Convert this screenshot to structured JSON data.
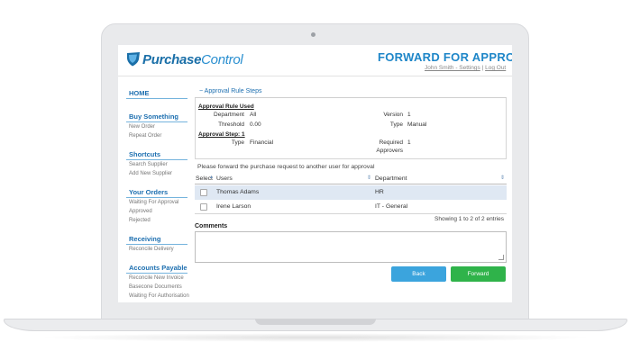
{
  "app": {
    "logo_part1": "Purchase",
    "logo_part2": "Control",
    "page_title": "FORWARD FOR APPROVAL",
    "user_link": "John Smith - Settings",
    "separator": "|",
    "logout_link": "Log Out"
  },
  "sidebar": {
    "home": "HOME",
    "buy_something": {
      "heading": "Buy Something",
      "items": [
        "New Order",
        "Repeat Order"
      ]
    },
    "shortcuts": {
      "heading": "Shortcuts",
      "items": [
        "Search Supplier",
        "Add New Supplier"
      ]
    },
    "your_orders": {
      "heading": "Your Orders",
      "items": [
        "Waiting For Approval",
        "Approved",
        "Rejected"
      ]
    },
    "receiving": {
      "heading": "Receiving",
      "items": [
        "Reconcile Delivery"
      ]
    },
    "accounts_payable": {
      "heading": "Accounts Payable",
      "items": [
        "Reconcile New Invoice",
        "Basecone Documents",
        "Waiting For Authorisation"
      ]
    }
  },
  "rules": {
    "toggle": "−",
    "header": "Approval Rule Steps",
    "used_heading": "Approval Rule Used",
    "department_label": "Department",
    "department_value": "All",
    "threshold_label": "Threshold",
    "threshold_value": "0.00",
    "version_label": "Version",
    "version_value": "1",
    "type_label": "Type",
    "type_value": "Manual",
    "step_heading": "Approval Step: 1",
    "step_type_label": "Type",
    "step_type_value": "Financial",
    "required_label_1": "Required",
    "required_label_2": "Approvers",
    "required_value": "1"
  },
  "message": "Please forward the purchase request to another user for approval",
  "table": {
    "headers": [
      "Select",
      "Users",
      "Department"
    ],
    "rows": [
      {
        "user": "Thomas Adams",
        "department": "HR"
      },
      {
        "user": "Irene Larson",
        "department": "IT - General"
      }
    ],
    "showing": "Showing 1 to 2 of 2 entries"
  },
  "comments": {
    "label": "Comments",
    "value": ""
  },
  "buttons": {
    "back": "Back",
    "forward": "Forward"
  },
  "colors": {
    "brand": "#1e86c8",
    "back_button": "#3ba4dd",
    "forward_button": "#2fb34a",
    "selected_row": "#dfe8f3"
  },
  "icons": {
    "logo": "shield-logo-icon",
    "sort": "sort-icon",
    "collapse": "collapse-icon"
  }
}
